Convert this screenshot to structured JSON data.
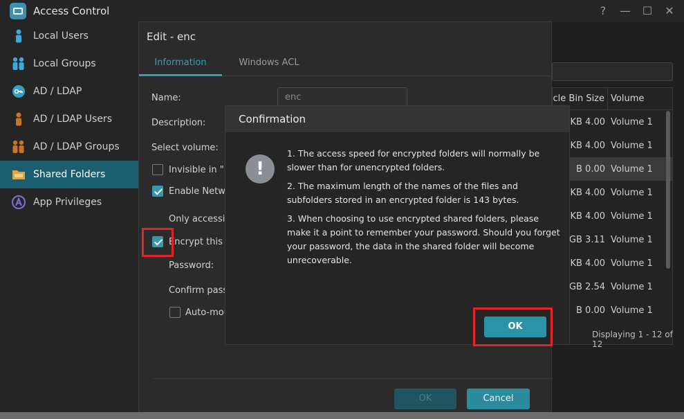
{
  "app": {
    "title": "Access Control",
    "window_buttons": [
      "?",
      "—",
      "☐",
      "✕"
    ]
  },
  "sidebar": {
    "items": [
      {
        "label": "Local Users",
        "icon": "user-icon"
      },
      {
        "label": "Local Groups",
        "icon": "group-icon"
      },
      {
        "label": "AD / LDAP",
        "icon": "key-icon"
      },
      {
        "label": "AD / LDAP Users",
        "icon": "user-icon"
      },
      {
        "label": "AD / LDAP Groups",
        "icon": "group-icon"
      },
      {
        "label": "Shared Folders",
        "icon": "folder-icon",
        "active": true
      },
      {
        "label": "App Privileges",
        "icon": "app-icon"
      }
    ]
  },
  "background_table": {
    "header_col1": "Recycle Bin Size",
    "header_col2": "Volume",
    "rows": [
      {
        "size": "4.00 KB",
        "volume": "Volume 1"
      },
      {
        "size": "4.00 KB",
        "volume": "Volume 1"
      },
      {
        "size": "0.00 B",
        "volume": "Volume 1",
        "selected": true
      },
      {
        "size": "4.00 KB",
        "volume": "Volume 1"
      },
      {
        "size": "4.00 KB",
        "volume": "Volume 1"
      },
      {
        "size": "3.11 GB",
        "volume": "Volume 1"
      },
      {
        "size": "4.00 KB",
        "volume": "Volume 1"
      },
      {
        "size": "2.54 GB",
        "volume": "Volume 1"
      },
      {
        "size": "0.00 B",
        "volume": "Volume 1"
      }
    ],
    "footer": "Displaying 1 - 12 of 12"
  },
  "edit_dialog": {
    "title": "Edit - enc",
    "tabs": [
      "Information",
      "Windows ACL"
    ],
    "name_label": "Name:",
    "name_value": "enc",
    "description_label": "Description:",
    "select_volume_label": "Select volume:",
    "invisible_label": "Invisible in \"Ne",
    "enable_network_label": "Enable Networ",
    "only_accessible_label": "Only accessibl",
    "encrypt_label": "Encrypt this sh",
    "password_label": "Password:",
    "confirm_password_label": "Confirm passw",
    "automount_label": "Auto-mou",
    "ok_label": "OK",
    "cancel_label": "Cancel"
  },
  "confirmation": {
    "title": "Confirmation",
    "messages": [
      "1. The access speed for encrypted folders will normally be slower than for unencrypted folders.",
      "2. The maximum length of the names of the files and subfolders stored in an encrypted folder is 143 bytes.",
      "3. When choosing to use encrypted shared folders, please make it a point to remember your password. Should you forget your password, the data in the shared folder will become unrecoverable."
    ],
    "icon_glyph": "!",
    "ok_label": "OK"
  },
  "colors": {
    "accent": "#2a93a8",
    "highlight": "#e0242a",
    "sidebar_active": "#1b5e70"
  }
}
